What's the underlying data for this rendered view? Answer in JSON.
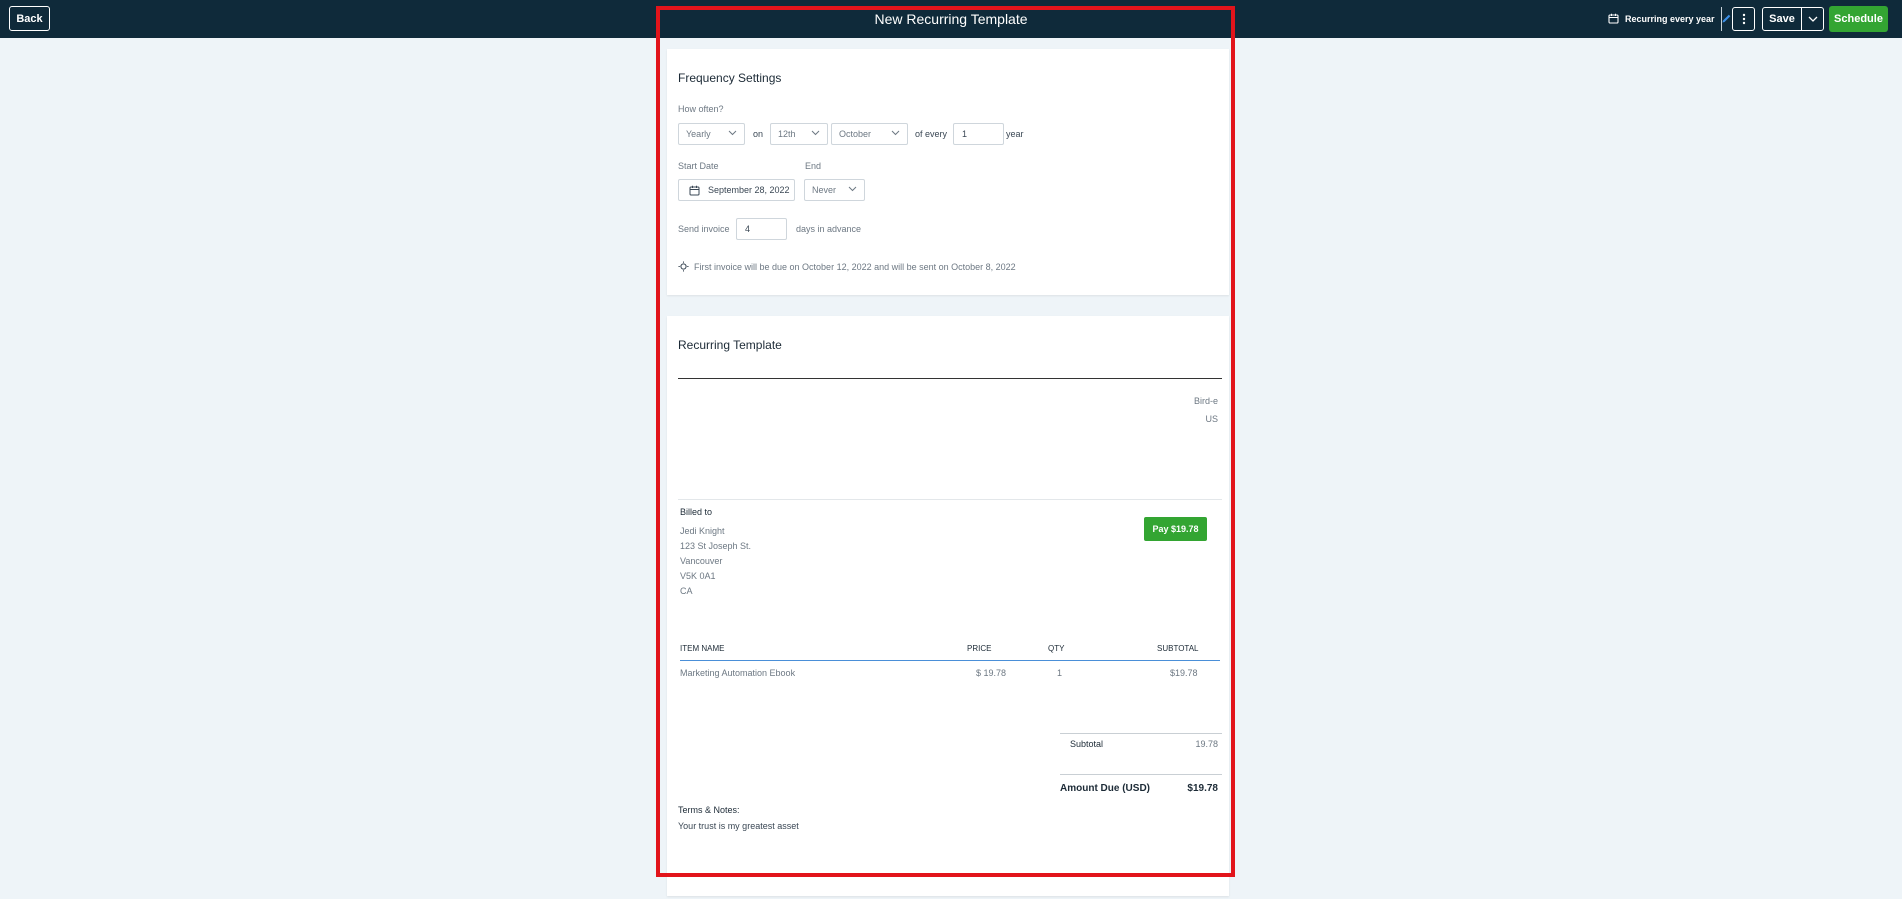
{
  "header": {
    "back_label": "Back",
    "title": "New Recurring Template",
    "recurring_label": "Recurring every year",
    "save_label": "Save",
    "schedule_label": "Schedule"
  },
  "frequency": {
    "title": "Frequency Settings",
    "how_often_label": "How often?",
    "period_value": "Yearly",
    "on_label": "on",
    "day_value": "12th",
    "month_value": "October",
    "of_every_label": "of every",
    "interval_value": "1",
    "unit_label": "year",
    "start_date_label": "Start Date",
    "start_date_value": "September 28, 2022",
    "end_label": "End",
    "end_value": "Never",
    "send_invoice_label": "Send invoice",
    "send_days_value": "4",
    "days_advance_label": "days in advance",
    "info_text": "First invoice will be due on October 12, 2022 and will be sent on October 8, 2022"
  },
  "template": {
    "title": "Recurring Template",
    "company_name": "Bird-e",
    "company_country": "US",
    "billed_to_label": "Billed to",
    "billed_to": [
      "Jedi Knight",
      "123 St Joseph St.",
      "Vancouver",
      "V5K 0A1",
      "CA"
    ],
    "pay_button": "Pay $19.78",
    "columns": {
      "item": "ITEM NAME",
      "price": "PRICE",
      "qty": "QTY",
      "subtotal": "SUBTOTAL"
    },
    "items": [
      {
        "name": "Marketing Automation Ebook",
        "price": "$ 19.78",
        "qty": "1",
        "subtotal": "$19.78"
      }
    ],
    "subtotal_label": "Subtotal",
    "subtotal_value": "19.78",
    "amount_due_label": "Amount Due (USD)",
    "amount_due_value": "$19.78",
    "terms_label": "Terms & Notes:",
    "terms_text": "Your trust is my greatest asset"
  },
  "colors": {
    "header_bg": "#0f2a3a",
    "accent_green": "#33a532",
    "highlight_red": "#e2141b",
    "page_bg": "#eef4f8"
  }
}
